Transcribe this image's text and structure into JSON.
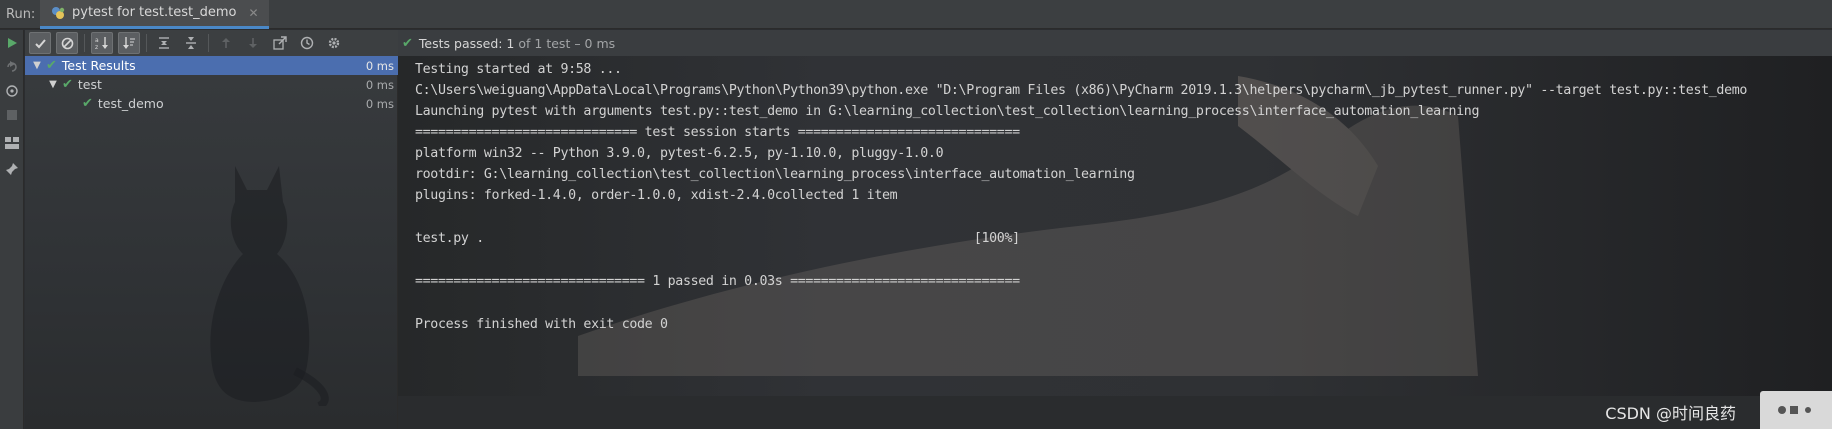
{
  "runbar": {
    "label": "Run:",
    "tab_label": "pytest for test.test_demo",
    "tab_close": "✕"
  },
  "status": {
    "passed_text": "Tests passed: 1",
    "detail_text": "of 1 test – 0 ms"
  },
  "tree": {
    "rows": [
      {
        "label": "Test Results",
        "duration": "0 ms"
      },
      {
        "label": "test",
        "duration": "0 ms"
      },
      {
        "label": "test_demo",
        "duration": "0 ms"
      }
    ]
  },
  "console": {
    "lines": [
      "Testing started at 9:58 ...",
      "C:\\Users\\weiguang\\AppData\\Local\\Programs\\Python\\Python39\\python.exe \"D:\\Program Files (x86)\\PyCharm 2019.1.3\\helpers\\pycharm\\_jb_pytest_runner.py\" --target test.py::test_demo",
      "Launching pytest with arguments test.py::test_demo in G:\\learning_collection\\test_collection\\learning_process\\interface_automation_learning",
      "============================= test session starts =============================",
      "platform win32 -- Python 3.9.0, pytest-6.2.5, py-1.10.0, pluggy-1.0.0",
      "rootdir: G:\\learning_collection\\test_collection\\learning_process\\interface_automation_learning",
      "plugins: forked-1.4.0, order-1.0.0, xdist-2.4.0collected 1 item",
      "test.py .                                                                [100%]",
      "============================== 1 passed in 0.03s ==============================",
      "Process finished with exit code 0"
    ]
  },
  "watermark": "CSDN @时间良药",
  "colors": {
    "pass_green": "#59a869",
    "selection_blue": "#4b6eaf",
    "tab_underline": "#4a88c7"
  }
}
